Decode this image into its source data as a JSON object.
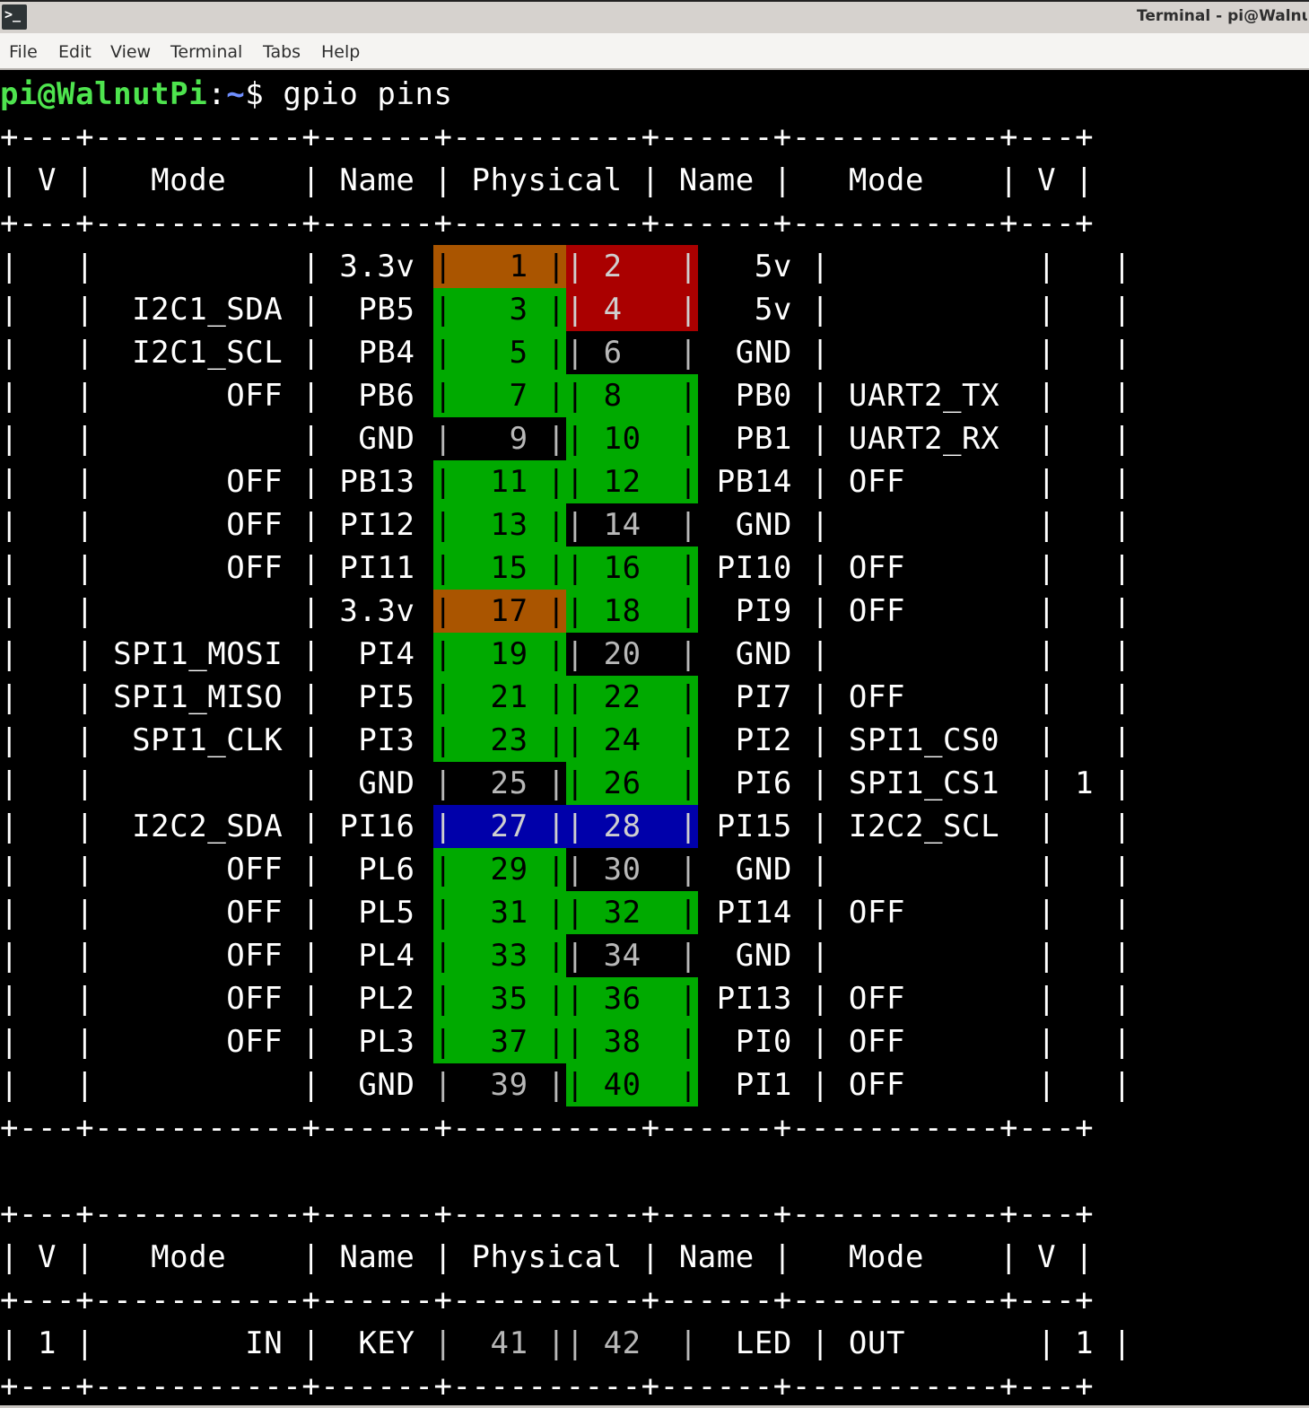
{
  "window": {
    "title": "Terminal - pi@WalnutPi: ~",
    "app_icon": "terminal-icon"
  },
  "menu": [
    "File",
    "Edit",
    "View",
    "Terminal",
    "Tabs",
    "Help"
  ],
  "prompt": {
    "user_host": "pi@WalnutPi",
    "separator": ":",
    "path": "~",
    "symbol": "$ ",
    "command": "gpio pins"
  },
  "colors": {
    "green": "#00aa00",
    "orange": "#aa5500",
    "red": "#aa0000",
    "blue": "#0000aa"
  },
  "table_header": {
    "v": "V",
    "mode": "Mode",
    "name": "Name",
    "physical": "Physical"
  },
  "main_table": [
    {
      "lv": "",
      "lmode": "",
      "lname": "3.3v",
      "lpin": "1",
      "lcolor": "orange",
      "rpin": "2",
      "rcolor": "red",
      "rname": "5v",
      "rmode": "",
      "rv": ""
    },
    {
      "lv": "",
      "lmode": "I2C1_SDA",
      "lname": "PB5",
      "lpin": "3",
      "lcolor": "green",
      "rpin": "4",
      "rcolor": "red",
      "rname": "5v",
      "rmode": "",
      "rv": ""
    },
    {
      "lv": "",
      "lmode": "I2C1_SCL",
      "lname": "PB4",
      "lpin": "5",
      "lcolor": "green",
      "rpin": "6",
      "rcolor": "none",
      "rname": "GND",
      "rmode": "",
      "rv": ""
    },
    {
      "lv": "",
      "lmode": "OFF",
      "lname": "PB6",
      "lpin": "7",
      "lcolor": "green",
      "rpin": "8",
      "rcolor": "green",
      "rname": "PB0",
      "rmode": "UART2_TX",
      "rv": ""
    },
    {
      "lv": "",
      "lmode": "",
      "lname": "GND",
      "lpin": "9",
      "lcolor": "none",
      "rpin": "10",
      "rcolor": "green",
      "rname": "PB1",
      "rmode": "UART2_RX",
      "rv": ""
    },
    {
      "lv": "",
      "lmode": "OFF",
      "lname": "PB13",
      "lpin": "11",
      "lcolor": "green",
      "rpin": "12",
      "rcolor": "green",
      "rname": "PB14",
      "rmode": "OFF",
      "rv": ""
    },
    {
      "lv": "",
      "lmode": "OFF",
      "lname": "PI12",
      "lpin": "13",
      "lcolor": "green",
      "rpin": "14",
      "rcolor": "none",
      "rname": "GND",
      "rmode": "",
      "rv": ""
    },
    {
      "lv": "",
      "lmode": "OFF",
      "lname": "PI11",
      "lpin": "15",
      "lcolor": "green",
      "rpin": "16",
      "rcolor": "green",
      "rname": "PI10",
      "rmode": "OFF",
      "rv": ""
    },
    {
      "lv": "",
      "lmode": "",
      "lname": "3.3v",
      "lpin": "17",
      "lcolor": "orange",
      "rpin": "18",
      "rcolor": "green",
      "rname": "PI9",
      "rmode": "OFF",
      "rv": ""
    },
    {
      "lv": "",
      "lmode": "SPI1_MOSI",
      "lname": "PI4",
      "lpin": "19",
      "lcolor": "green",
      "rpin": "20",
      "rcolor": "none",
      "rname": "GND",
      "rmode": "",
      "rv": ""
    },
    {
      "lv": "",
      "lmode": "SPI1_MISO",
      "lname": "PI5",
      "lpin": "21",
      "lcolor": "green",
      "rpin": "22",
      "rcolor": "green",
      "rname": "PI7",
      "rmode": "OFF",
      "rv": ""
    },
    {
      "lv": "",
      "lmode": "SPI1_CLK",
      "lname": "PI3",
      "lpin": "23",
      "lcolor": "green",
      "rpin": "24",
      "rcolor": "green",
      "rname": "PI2",
      "rmode": "SPI1_CS0",
      "rv": ""
    },
    {
      "lv": "",
      "lmode": "",
      "lname": "GND",
      "lpin": "25",
      "lcolor": "none",
      "rpin": "26",
      "rcolor": "green",
      "rname": "PI6",
      "rmode": "SPI1_CS1",
      "rv": "1"
    },
    {
      "lv": "",
      "lmode": "I2C2_SDA",
      "lname": "PI16",
      "lpin": "27",
      "lcolor": "blue",
      "rpin": "28",
      "rcolor": "blue",
      "rname": "PI15",
      "rmode": "I2C2_SCL",
      "rv": ""
    },
    {
      "lv": "",
      "lmode": "OFF",
      "lname": "PL6",
      "lpin": "29",
      "lcolor": "green",
      "rpin": "30",
      "rcolor": "none",
      "rname": "GND",
      "rmode": "",
      "rv": ""
    },
    {
      "lv": "",
      "lmode": "OFF",
      "lname": "PL5",
      "lpin": "31",
      "lcolor": "green",
      "rpin": "32",
      "rcolor": "green",
      "rname": "PI14",
      "rmode": "OFF",
      "rv": ""
    },
    {
      "lv": "",
      "lmode": "OFF",
      "lname": "PL4",
      "lpin": "33",
      "lcolor": "green",
      "rpin": "34",
      "rcolor": "none",
      "rname": "GND",
      "rmode": "",
      "rv": ""
    },
    {
      "lv": "",
      "lmode": "OFF",
      "lname": "PL2",
      "lpin": "35",
      "lcolor": "green",
      "rpin": "36",
      "rcolor": "green",
      "rname": "PI13",
      "rmode": "OFF",
      "rv": ""
    },
    {
      "lv": "",
      "lmode": "OFF",
      "lname": "PL3",
      "lpin": "37",
      "lcolor": "green",
      "rpin": "38",
      "rcolor": "green",
      "rname": "PI0",
      "rmode": "OFF",
      "rv": ""
    },
    {
      "lv": "",
      "lmode": "",
      "lname": "GND",
      "lpin": "39",
      "lcolor": "none",
      "rpin": "40",
      "rcolor": "green",
      "rname": "PI1",
      "rmode": "OFF",
      "rv": ""
    }
  ],
  "extra_table": [
    {
      "lv": "1",
      "lmode": "IN",
      "lname": "KEY",
      "lpin": "41",
      "lcolor": "none",
      "rpin": "42",
      "rcolor": "none",
      "rname": "LED",
      "rmode": "OUT",
      "rv": "1"
    }
  ]
}
